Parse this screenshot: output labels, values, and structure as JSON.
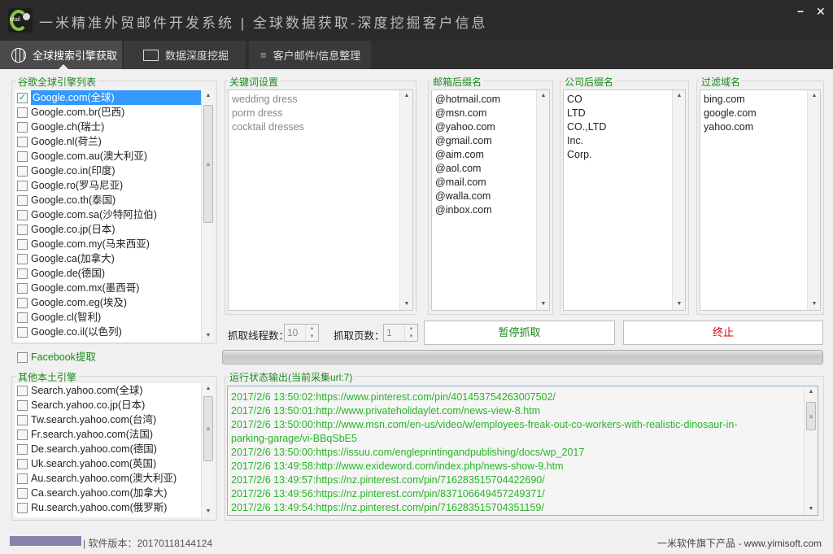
{
  "app": {
    "title": "一米精准外贸邮件开发系统 | 全球数据获取-深度挖掘客户信息",
    "logo_text": "Mail",
    "minimize": "−",
    "close": "✕"
  },
  "tabs": [
    {
      "label": "全球搜索引擎获取",
      "icon": "globe-icon"
    },
    {
      "label": "数据深度挖掘",
      "icon": "mail-search-icon"
    },
    {
      "label": "客户邮件/信息整理",
      "icon": "menu-icon"
    }
  ],
  "google": {
    "title": "谷歌全球引擎列表",
    "items": [
      {
        "label": "Google.com(全球)",
        "checked": true
      },
      {
        "label": "Google.com.br(巴西)"
      },
      {
        "label": "Google.ch(瑞士)"
      },
      {
        "label": "Google.nl(荷兰)"
      },
      {
        "label": "Google.com.au(澳大利亚)"
      },
      {
        "label": "Google.co.in(印度)"
      },
      {
        "label": "Google.ro(罗马尼亚)"
      },
      {
        "label": "Google.co.th(泰国)"
      },
      {
        "label": "Google.com.sa(沙特阿拉伯)"
      },
      {
        "label": "Google.co.jp(日本)"
      },
      {
        "label": "Google.com.my(马来西亚)"
      },
      {
        "label": "Google.ca(加拿大)"
      },
      {
        "label": "Google.de(德国)"
      },
      {
        "label": "Google.com.mx(墨西哥)"
      },
      {
        "label": "Google.com.eg(埃及)"
      },
      {
        "label": "Google.cl(智利)"
      },
      {
        "label": "Google.co.il(以色列)"
      }
    ]
  },
  "facebook": {
    "label": "Facebook提取",
    "checked": false
  },
  "local": {
    "title": "其他本土引擎",
    "items": [
      {
        "label": "Search.yahoo.com(全球)"
      },
      {
        "label": "Search.yahoo.co.jp(日本)"
      },
      {
        "label": "Tw.search.yahoo.com(台湾)"
      },
      {
        "label": "Fr.search.yahoo.com(法国)"
      },
      {
        "label": "De.search.yahoo.com(德国)"
      },
      {
        "label": "Uk.search.yahoo.com(英国)"
      },
      {
        "label": "Au.search.yahoo.com(澳大利亚)"
      },
      {
        "label": "Ca.search.yahoo.com(加拿大)"
      },
      {
        "label": "Ru.search.yahoo.com(俄罗斯)"
      }
    ]
  },
  "keywords": {
    "title": "关键词设置",
    "items": [
      "wedding dress",
      "porm dress",
      "cocktail dresses"
    ]
  },
  "email_suffix": {
    "title": "邮箱后缀名",
    "items": [
      "@hotmail.com",
      "@msn.com",
      "@yahoo.com",
      "@gmail.com",
      "@aim.com",
      "@aol.com",
      "@mail.com",
      "@walla.com",
      "@inbox.com"
    ]
  },
  "company_suffix": {
    "title": "公司后缀名",
    "items": [
      "CO",
      "LTD",
      "CO.,LTD",
      "Inc.",
      "Corp."
    ]
  },
  "filter_domains": {
    "title": "过滤域名",
    "items": [
      "bing.com",
      "google.com",
      "yahoo.com"
    ]
  },
  "controls": {
    "threads_label": "抓取线程数：",
    "threads_value": "10",
    "pages_label": "抓取页数：",
    "pages_value": "1",
    "pause_label": "暂停抓取",
    "stop_label": "终止",
    "progress_percent": 0
  },
  "log": {
    "title": "运行状态输出(当前采集url:7)",
    "lines": [
      "2017/2/6 13:50:02:https://www.pinterest.com/pin/401453754263007502/",
      "2017/2/6 13:50:01:http://www.privateholidaylet.com/news-view-8.htm",
      "2017/2/6 13:50:00:http://www.msn.com/en-us/video/w/employees-freak-out-co-workers-with-realistic-dinosaur-in-",
      "parking-garage/vi-BBqSbE5",
      "2017/2/6 13:50:00:https://issuu.com/engleprintingandpublishing/docs/wp_2017",
      "2017/2/6 13:49:58:http://www.exideword.com/index.php/news-show-9.htm",
      "2017/2/6 13:49:57:https://nz.pinterest.com/pin/716283515704422690/",
      "2017/2/6 13:49:56:https://nz.pinterest.com/pin/837106649457249371/",
      "2017/2/6 13:49:54:https://nz.pinterest.com/pin/716283515704351159/"
    ]
  },
  "status": {
    "version": "| 软件版本：20170118144124",
    "brand": "一米软件旗下产品 - www.yimisoft.com"
  },
  "colors": {
    "green": "#1a8a1a",
    "red": "#e00000",
    "log_green": "#28b428",
    "selection": "#3399ff"
  }
}
